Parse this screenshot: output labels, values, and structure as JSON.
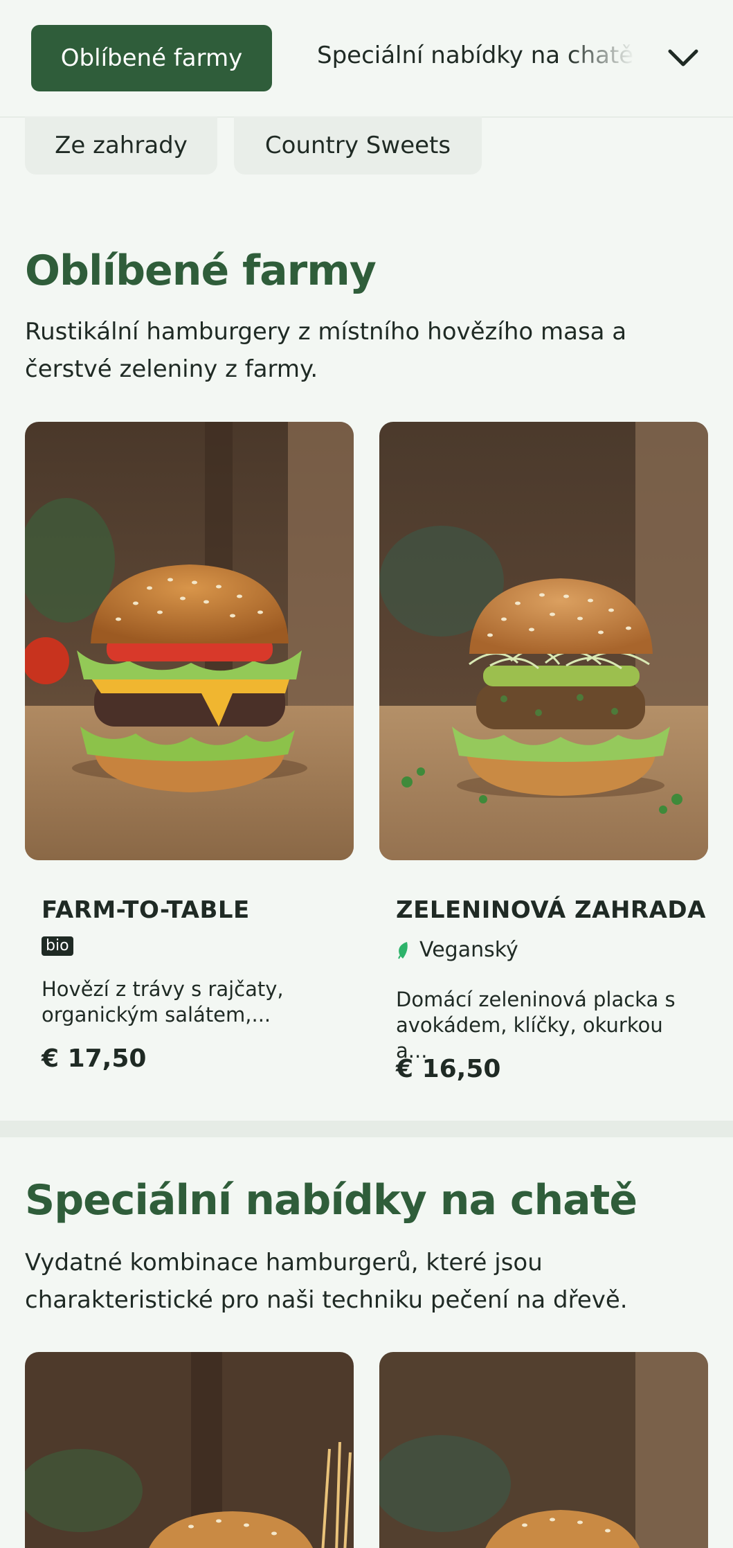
{
  "nav": {
    "active_tab": "Oblíbené farmy",
    "next_tab": "Speciální nabídky na chatě",
    "chevron_icon": "chevron-down-icon",
    "chips": [
      "Ze zahrady",
      "Country Sweets"
    ]
  },
  "sections": [
    {
      "title": "Oblíbené farmy",
      "description": "Rustikální hamburgery z místního hovězího masa a čerstvé zeleniny z farmy.",
      "items": [
        {
          "name": "FARM-TO-TABLE",
          "badge": "bio",
          "description": "Hovězí z trávy s rajčaty, organickým salátem,...",
          "price": "€ 17,50"
        },
        {
          "name": "ZELENINOVÁ ZAHRADA",
          "tag": "Veganský",
          "tag_icon": "leaf-icon",
          "description": "Domácí zeleninová placka s avokádem, klíčky, okurkou a...",
          "price": "€ 16,50"
        }
      ]
    },
    {
      "title": "Speciální nabídky na chatě",
      "description": "Vydatné kombinace hamburgerů, které jsou charakteristické pro naši techniku pečení na dřevě."
    }
  ],
  "colors": {
    "brand": "#2f5d3a",
    "background": "#f3f7f3",
    "vegan_leaf": "#2db36a"
  }
}
